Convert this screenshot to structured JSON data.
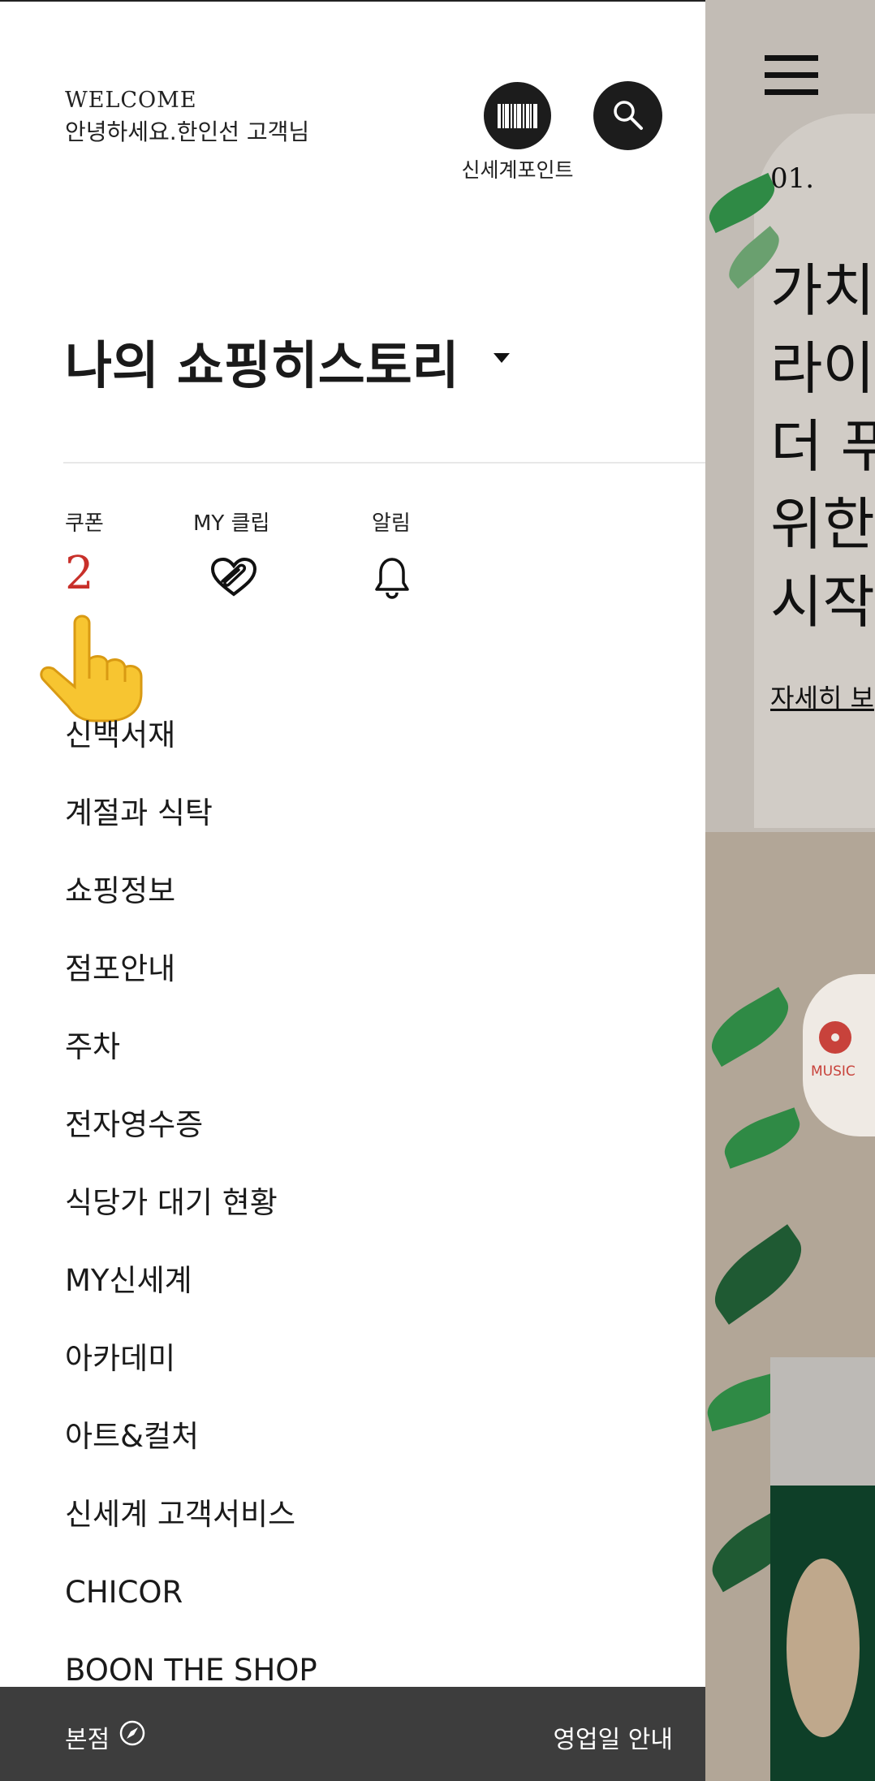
{
  "drawer": {
    "welcome_en": "WELCOME",
    "welcome_ko": "안녕하세요.한인선 고객님",
    "points_label": "신세계포인트",
    "history_title": "나의 쇼핑히스토리",
    "quick": {
      "coupon_label": "쿠폰",
      "coupon_count": "2",
      "clip_label": "MY 클립",
      "alarm_label": "알림"
    },
    "menu": [
      "신백서재",
      "계절과 식탁",
      "쇼핑정보",
      "점포안내",
      "주차",
      "전자영수증",
      "식당가 대기 현황",
      "MY신세계",
      "아카데미",
      "아트&컬처",
      "신세계 고객서비스",
      "CHICOR",
      "BOON THE SHOP"
    ],
    "bottom": {
      "store": "본점",
      "hours": "영업일 안내"
    }
  },
  "background": {
    "number": "01.",
    "headline_lines": [
      "가치",
      "라이",
      "더 푸",
      "위한",
      "시작"
    ],
    "more_link": "자세히 보",
    "music_label": "MUSIC"
  },
  "colors": {
    "accent_red": "#c8302a",
    "dark_button": "#1c1c1c",
    "bottom_bar": "#3d3d3d"
  },
  "icons": [
    "barcode-icon",
    "search-icon",
    "heart-clip-icon",
    "bell-icon",
    "caret-down-icon",
    "compass-icon",
    "hamburger-icon",
    "music-icon",
    "pointing-hand-icon"
  ]
}
